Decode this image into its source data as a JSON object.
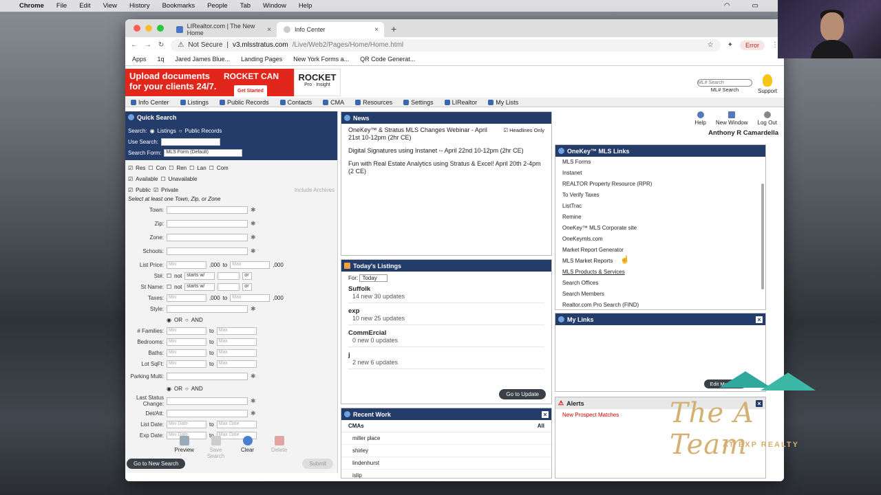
{
  "menubar": {
    "app": "Chrome",
    "items": [
      "File",
      "Edit",
      "View",
      "History",
      "Bookmarks",
      "People",
      "Tab",
      "Window",
      "Help"
    ]
  },
  "tabs": [
    {
      "label": "LIRealtor.com | The New Home"
    },
    {
      "label": "Info Center"
    }
  ],
  "address": {
    "security": "Not Secure",
    "host": "v3.mlsstratus.com",
    "path": "/Live/Web2/Pages/Home/Home.html",
    "profile_status": "Error"
  },
  "bookmarks": [
    "Apps",
    "1q",
    "Jared James Blue...",
    "Landing Pages",
    "New York Forms a...",
    "QR Code Generat..."
  ],
  "banner": {
    "text1": "Upload documents",
    "text2": "for your clients 24/7.",
    "brand": "ROCKET CAN",
    "cta": "Get Started",
    "partner": "ROCKET",
    "partner_sub": "Pro · Insight"
  },
  "header": {
    "mls_search_placeholder": "ML# Search",
    "mls_search_label": "ML# Search",
    "support": "Support"
  },
  "nav": [
    "Info Center",
    "Listings",
    "Public Records",
    "Contacts",
    "CMA",
    "Resources",
    "Settings",
    "LIRealtor",
    "My Lists"
  ],
  "quick_search": {
    "title": "Quick Search",
    "search_label": "Search:",
    "search_opts": [
      "Listings",
      "Public Records"
    ],
    "use_search": "Use Search:",
    "search_form_label": "Search Form:",
    "search_form_value": "MLS Form (Default)",
    "types": [
      "Res",
      "Con",
      "Ren",
      "Lan",
      "Com"
    ],
    "status": [
      "Available",
      "Unavailable"
    ],
    "visibility": [
      "Public",
      "Private"
    ],
    "include_archives": "Include Archives",
    "hint": "Select at least one Town, Zip, or Zone",
    "fields": {
      "town": "Town:",
      "zip": "Zip:",
      "zone": "Zone:",
      "schools": "Schools:",
      "list_price": "List Price:",
      "st_num": "St#:",
      "st_name": "St Name:",
      "taxes": "Taxes:",
      "style": "Style:",
      "families": "# Families:",
      "bedrooms": "Bedrooms:",
      "baths": "Baths:",
      "lot_sqft": "Lot SqFt:",
      "parking": "Parking Multi:",
      "last_status": "Last Status Change:",
      "det_att": "Det/Att:",
      "list_date": "List Date:",
      "exp_date": "Exp Date:"
    },
    "min": "Min",
    "max": "Max",
    "to": "to",
    "thousands": ",000",
    "not": "not",
    "starts_with": "starts w/",
    "or": "or",
    "or_opt": "OR",
    "and_opt": "AND",
    "min_date": "Min Date",
    "max_date": "Max Date",
    "buttons": [
      "Preview",
      "Save Search",
      "Clear",
      "Delete"
    ],
    "go_new": "Go to New Search",
    "submit": "Submit"
  },
  "news": {
    "title": "News",
    "headlines_only": "Headlines Only",
    "items": [
      "OneKey™ & Stratus MLS Changes Webinar - April 21st 10-12pm (2hr CE)",
      "Digital Signatures using Instanet -- April 22nd 10-12pm (2hr CE)",
      "Fun with Real Estate Analytics using Stratus & Excel! April 20th 2-4pm (2 CE)"
    ]
  },
  "todays_listings": {
    "title": "Today's Listings",
    "for_label": "For:",
    "for_value": "Today",
    "rows": [
      {
        "name": "Suffolk",
        "stat": "14 new   30 updates"
      },
      {
        "name": "exp",
        "stat": "10 new   25 updates"
      },
      {
        "name": "CommErcial",
        "stat": "0 new   0 updates"
      },
      {
        "name": "j",
        "stat": "2 new   6 updates"
      }
    ],
    "go_update": "Go to Update"
  },
  "recent_work": {
    "title": "Recent Work",
    "section": "CMAs",
    "all": "All",
    "items": [
      "miller place",
      "shirley",
      "lindenhurst",
      "islip"
    ]
  },
  "right_top": {
    "icons": [
      "Help",
      "New Window",
      "Log Out"
    ],
    "user": "Anthony R Camardella"
  },
  "onekey_links": {
    "title": "OneKey™ MLS Links",
    "items": [
      "MLS Forms",
      "Instanet",
      "REALTOR Property Resource (RPR)",
      "To Verify Taxes",
      "ListTrac",
      "Remine",
      "OneKey™ MLS Corporate site",
      "OneKeymls.com",
      "Market Report Generator",
      "MLS Market Reports",
      "MLS Products & Services",
      "Search Offices",
      "Search Members",
      "Realtor.com Pro Search (FIND)"
    ]
  },
  "my_links": {
    "title": "My Links",
    "edit": "Edit My Links"
  },
  "alerts": {
    "title": "Alerts",
    "items": [
      "New Prospect Matches"
    ]
  },
  "overlay": {
    "logo_main": "The A Team",
    "logo_sub": "AT EXP REALTY"
  }
}
